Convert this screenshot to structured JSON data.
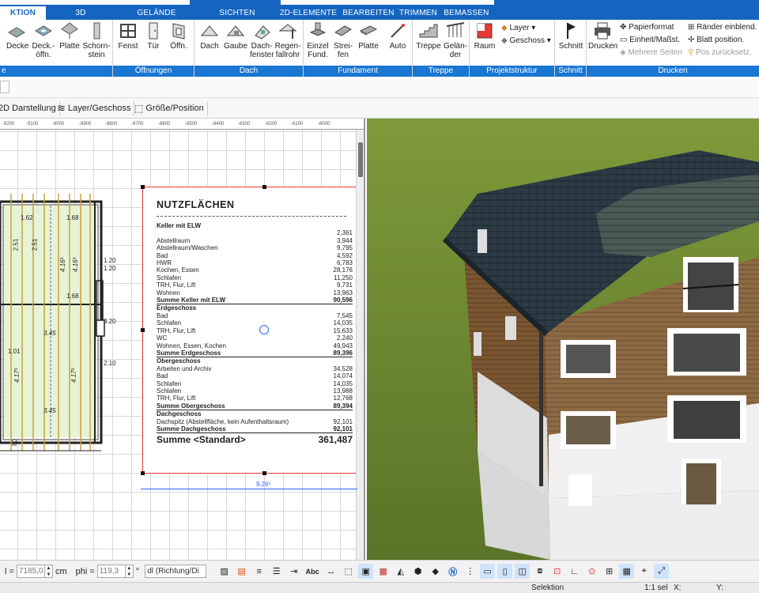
{
  "tabs": [
    {
      "label": "KTION",
      "active": true
    },
    {
      "label": "3D",
      "active": false
    },
    {
      "label": "GELÄNDE",
      "active": false
    },
    {
      "label": "SICHTEN",
      "active": false
    },
    {
      "label": "2D-ELEMENTE",
      "active": false
    },
    {
      "label": "BEARBEITEN",
      "active": false
    },
    {
      "label": "TRIMMEN",
      "active": false
    },
    {
      "label": "BEMASSEN",
      "active": false
    }
  ],
  "ribbon": {
    "group_first_title": "e",
    "group_oeffnungen": "Öffnungen",
    "group_dach": "Dach",
    "group_fundament": "Fundament",
    "group_treppe": "Treppe",
    "group_projektstruktur": "Projektstruktur",
    "group_schnitt": "Schnitt",
    "group_drucken": "Drucken",
    "btn_decke": "Decke",
    "btn_deckoeffn_1": "Deck.-",
    "btn_deckoeffn_2": "öffn.",
    "btn_platte": "Platte",
    "btn_schornstein_1": "Schorn-",
    "btn_schornstein_2": "stein",
    "btn_fenster": "Fenst",
    "btn_tuer": "Tür",
    "btn_oeffn": "Öffn.",
    "btn_dach": "Dach",
    "btn_gaube": "Gaube",
    "btn_dachfenster_1": "Dach-",
    "btn_dachfenster_2": "fenster",
    "btn_regen_1": "Regen-",
    "btn_regen_2": "fallrohr",
    "btn_einzel_1": "Einzel",
    "btn_einzel_2": "Fund.",
    "btn_streifen_1": "Strei-",
    "btn_streifen_2": "fen",
    "btn_fund_platte": "Platte",
    "btn_auto": "Auto",
    "btn_treppe": "Treppe",
    "btn_gelaender_1": "Gelän-",
    "btn_gelaender_2": "der",
    "btn_raum": "Raum",
    "btn_layer": "Layer ▾",
    "btn_geschoss": "Geschoss ▾",
    "btn_schnitt": "Schnitt",
    "btn_drucken": "Drucken",
    "btn_papierformat": "Papierformat",
    "btn_einheit": "Einheit/Maßst.",
    "btn_mehrere": "Mehrere Seiten",
    "btn_raender": "Ränder einblend.",
    "btn_blatt": "Blatt position.",
    "btn_pos": "Pos zurücksetz."
  },
  "toolbar3": {
    "darstellung": "2D Darstellung",
    "layer": "Layer/Geschoss",
    "groesse": "Größe/Position"
  },
  "ruler": [
    "-9200",
    "-9100",
    "-9000",
    "-8900",
    "-8800",
    "-8700",
    "-8600",
    "-8500",
    "-8400",
    "-8300",
    "-8200",
    "-8100",
    "-8000"
  ],
  "plan_labels": {
    "d1": "2.51",
    "d2": "2.51",
    "d3": "4.16⁵",
    "d4": "4.16⁵",
    "d5": "1.62",
    "d6": "1.68",
    "d7": "1.68",
    "d8": "3.45",
    "d9": "4.17⁵",
    "d10": "4.17⁵",
    "d11": "3.45",
    "d12": "1.01",
    "d13": "2.10",
    "d14": "3.20",
    "d15": "1.20",
    "d16": "1.20",
    "d17": "80"
  },
  "area_table": {
    "title": "NUTZFLÄCHEN",
    "sections": [
      {
        "title": "Keller mit ELW",
        "top_value": "2,361",
        "rows": [
          [
            "Abstellraum",
            "3,944"
          ],
          [
            "Abstellraum/Waschen",
            "9,795"
          ],
          [
            "Bad",
            "4,592"
          ],
          [
            "HWR",
            "6,783"
          ],
          [
            "Kochen, Essen",
            "28,176"
          ],
          [
            "Schlafen",
            "11,250"
          ],
          [
            "TRH, Flur, Lift",
            "9,731"
          ],
          [
            "Wohnen",
            "13,963"
          ]
        ],
        "sum_label": "Summe Keller mit ELW",
        "sum_value": "90,596"
      },
      {
        "title": "Erdgeschoss",
        "rows": [
          [
            "Bad",
            "7,545"
          ],
          [
            "Schlafen",
            "14,035"
          ],
          [
            "TRH, Flur, Lift",
            "15,633"
          ],
          [
            "WC",
            "2,240"
          ],
          [
            "Wohnen, Essen, Kochen",
            "49,943"
          ]
        ],
        "sum_label": "Summe Erdgeschoss",
        "sum_value": "89,396"
      },
      {
        "title": "Obergeschoss",
        "rows": [
          [
            "Arbeiten und Archiv",
            "34,528"
          ],
          [
            "Bad",
            "14,074"
          ],
          [
            "Schlafen",
            "14,035"
          ],
          [
            "Schlafen",
            "13,988"
          ],
          [
            "TRH, Flur, Lift",
            "12,768"
          ]
        ],
        "sum_label": "Summe Obergeschoss",
        "sum_value": "89,394"
      },
      {
        "title": "Dachgeschoss",
        "rows": [
          [
            "Dachspitz (Abstellfläche, kein Aufenthaltsraum)",
            "92,101"
          ]
        ],
        "sum_label": "Summe Dachgeschoss",
        "sum_value": "92,101"
      }
    ],
    "total_label": "Summe <Standard>",
    "total_value": "361,487"
  },
  "dimension_value": "9.26⁵",
  "bottom": {
    "l_label": "l =",
    "l_value": "7185,0",
    "l_unit": "cm",
    "phi_label": "phi =",
    "phi_value": "119,3",
    "phi_unit": "°",
    "dl_value": "dl (Richtung/Di"
  },
  "status": {
    "mode": "Selektion",
    "sel": "1:1 sel",
    "x": "X:",
    "y": "Y:"
  }
}
